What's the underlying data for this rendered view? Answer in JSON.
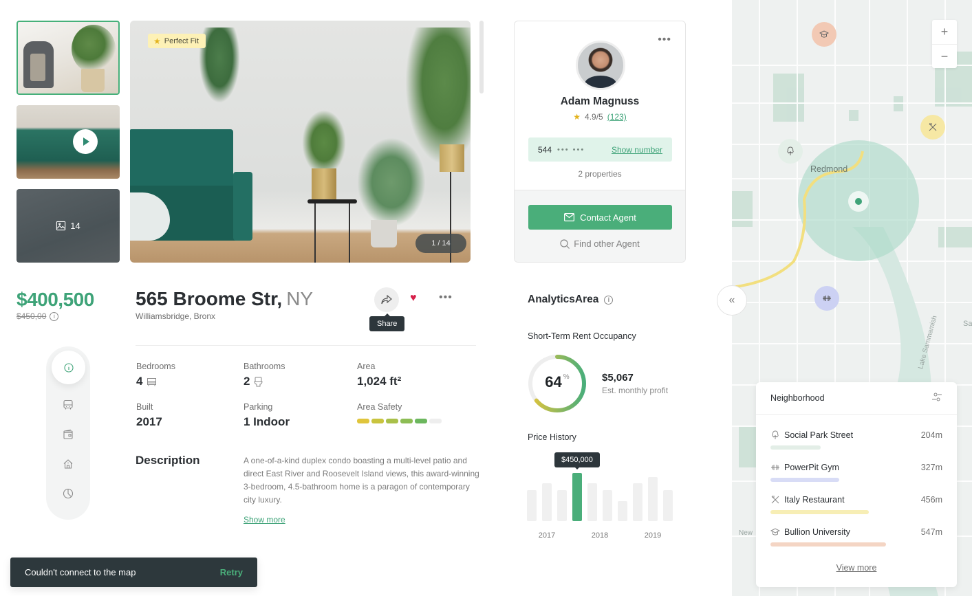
{
  "gallery": {
    "badge": "Perfect Fit",
    "badge_icon": "star-icon",
    "counter": "1 / 14",
    "more_count": "14",
    "thumbnails": [
      {
        "type": "photo",
        "selected": true
      },
      {
        "type": "video",
        "selected": false
      },
      {
        "type": "more",
        "selected": false
      }
    ]
  },
  "agent": {
    "name": "Adam Magnuss",
    "rating": "4.9/5",
    "reviews": "(123)",
    "phone_prefix": "544",
    "phone_mask": "••• •••",
    "show_number": "Show number",
    "properties": "2 properties",
    "contact_label": "Contact Agent",
    "find_label": "Find other Agent"
  },
  "listing": {
    "price": "$400,500",
    "old_price": "$450,00",
    "address": "565 Broome Str,",
    "state": "NY",
    "neighborhood": "Williamsbridge, Bronx",
    "share_tooltip": "Share",
    "favorited": true,
    "facts": [
      {
        "label": "Bedrooms",
        "value": "4",
        "icon": "bed-icon"
      },
      {
        "label": "Bathrooms",
        "value": "2",
        "icon": "toilet-icon"
      },
      {
        "label": "Area",
        "value": "1,024 ft²"
      },
      {
        "label": "Built",
        "value": "2017"
      },
      {
        "label": "Parking",
        "value": "1 Indoor"
      },
      {
        "label": "Area Safety",
        "value_segments": 5,
        "total_segments": 6,
        "segment_colors": [
          "#e0c53c",
          "#c9c43f",
          "#a9c04a",
          "#8dbd55",
          "#6cb75e",
          "#eeeeee"
        ]
      }
    ],
    "description_title": "Description",
    "description": "A one-of-a-kind duplex condo boasting a multi-level patio and direct East River and Roosevelt Island views, this award-winning 3-bedroom, 4.5-bathroom home is a paragon of contemporary city luxury.",
    "show_more": "Show more"
  },
  "side_nav": {
    "items": [
      {
        "icon": "info-icon",
        "active": true
      },
      {
        "icon": "bus-icon",
        "active": false
      },
      {
        "icon": "wallet-icon",
        "active": false
      },
      {
        "icon": "home-icon",
        "active": false
      },
      {
        "icon": "pie-chart-icon",
        "active": false
      }
    ]
  },
  "toast": {
    "message": "Couldn't connect to the map",
    "action": "Retry"
  },
  "analytics": {
    "title": "AnalyticsArea",
    "occupancy_title": "Short-Term Rent Occupancy",
    "occupancy_value": "64",
    "occupancy_unit": "%",
    "occupancy_fraction": 0.64,
    "profit": "$5,067",
    "profit_label": "Est. monthly profit",
    "price_history_title": "Price History"
  },
  "chart_data": {
    "type": "bar",
    "title": "Price History",
    "x_tick_labels": [
      "2017",
      "2018",
      "2019"
    ],
    "values_relative": [
      0.65,
      0.79,
      0.65,
      1.0,
      0.79,
      0.65,
      0.42,
      0.79,
      0.92,
      0.65
    ],
    "highlighted_index": 3,
    "highlighted_label": "$450,000",
    "highlight_color": "#4aae7a",
    "bar_color": "#f0f0f0"
  },
  "map": {
    "city_label": "Redmond",
    "lake_label": "Lake Sammamish",
    "edge_labels": [
      "Sa",
      "New"
    ],
    "zoom_in": "+",
    "zoom_out": "−",
    "collapse_icon": "«"
  },
  "neighborhood": {
    "title": "Neighborhood",
    "items": [
      {
        "name": "Social Park Street",
        "distance": "204m",
        "icon": "tree-icon",
        "color": "#e3eee7",
        "fraction": 0.29
      },
      {
        "name": "PowerPit Gym",
        "distance": "327m",
        "icon": "dumbbell-icon",
        "color": "#d8dcf6",
        "fraction": 0.4
      },
      {
        "name": "Italy Restaurant",
        "distance": "456m",
        "icon": "utensils-icon",
        "color": "#f7eeb5",
        "fraction": 0.57
      },
      {
        "name": "Bullion University",
        "distance": "547m",
        "icon": "graduation-cap-icon",
        "color": "#f4d5c4",
        "fraction": 0.67
      }
    ],
    "view_more": "View more"
  }
}
